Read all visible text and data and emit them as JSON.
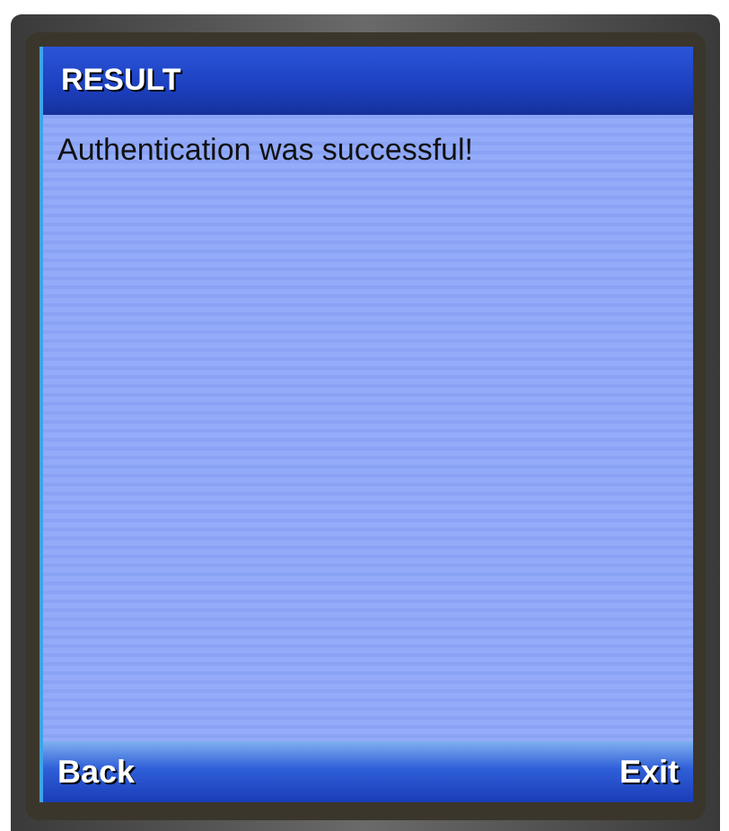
{
  "screen": {
    "title": "RESULT",
    "message": "Authentication was successful!"
  },
  "softkeys": [
    {
      "label": "Back"
    },
    {
      "label": "Exit"
    }
  ]
}
